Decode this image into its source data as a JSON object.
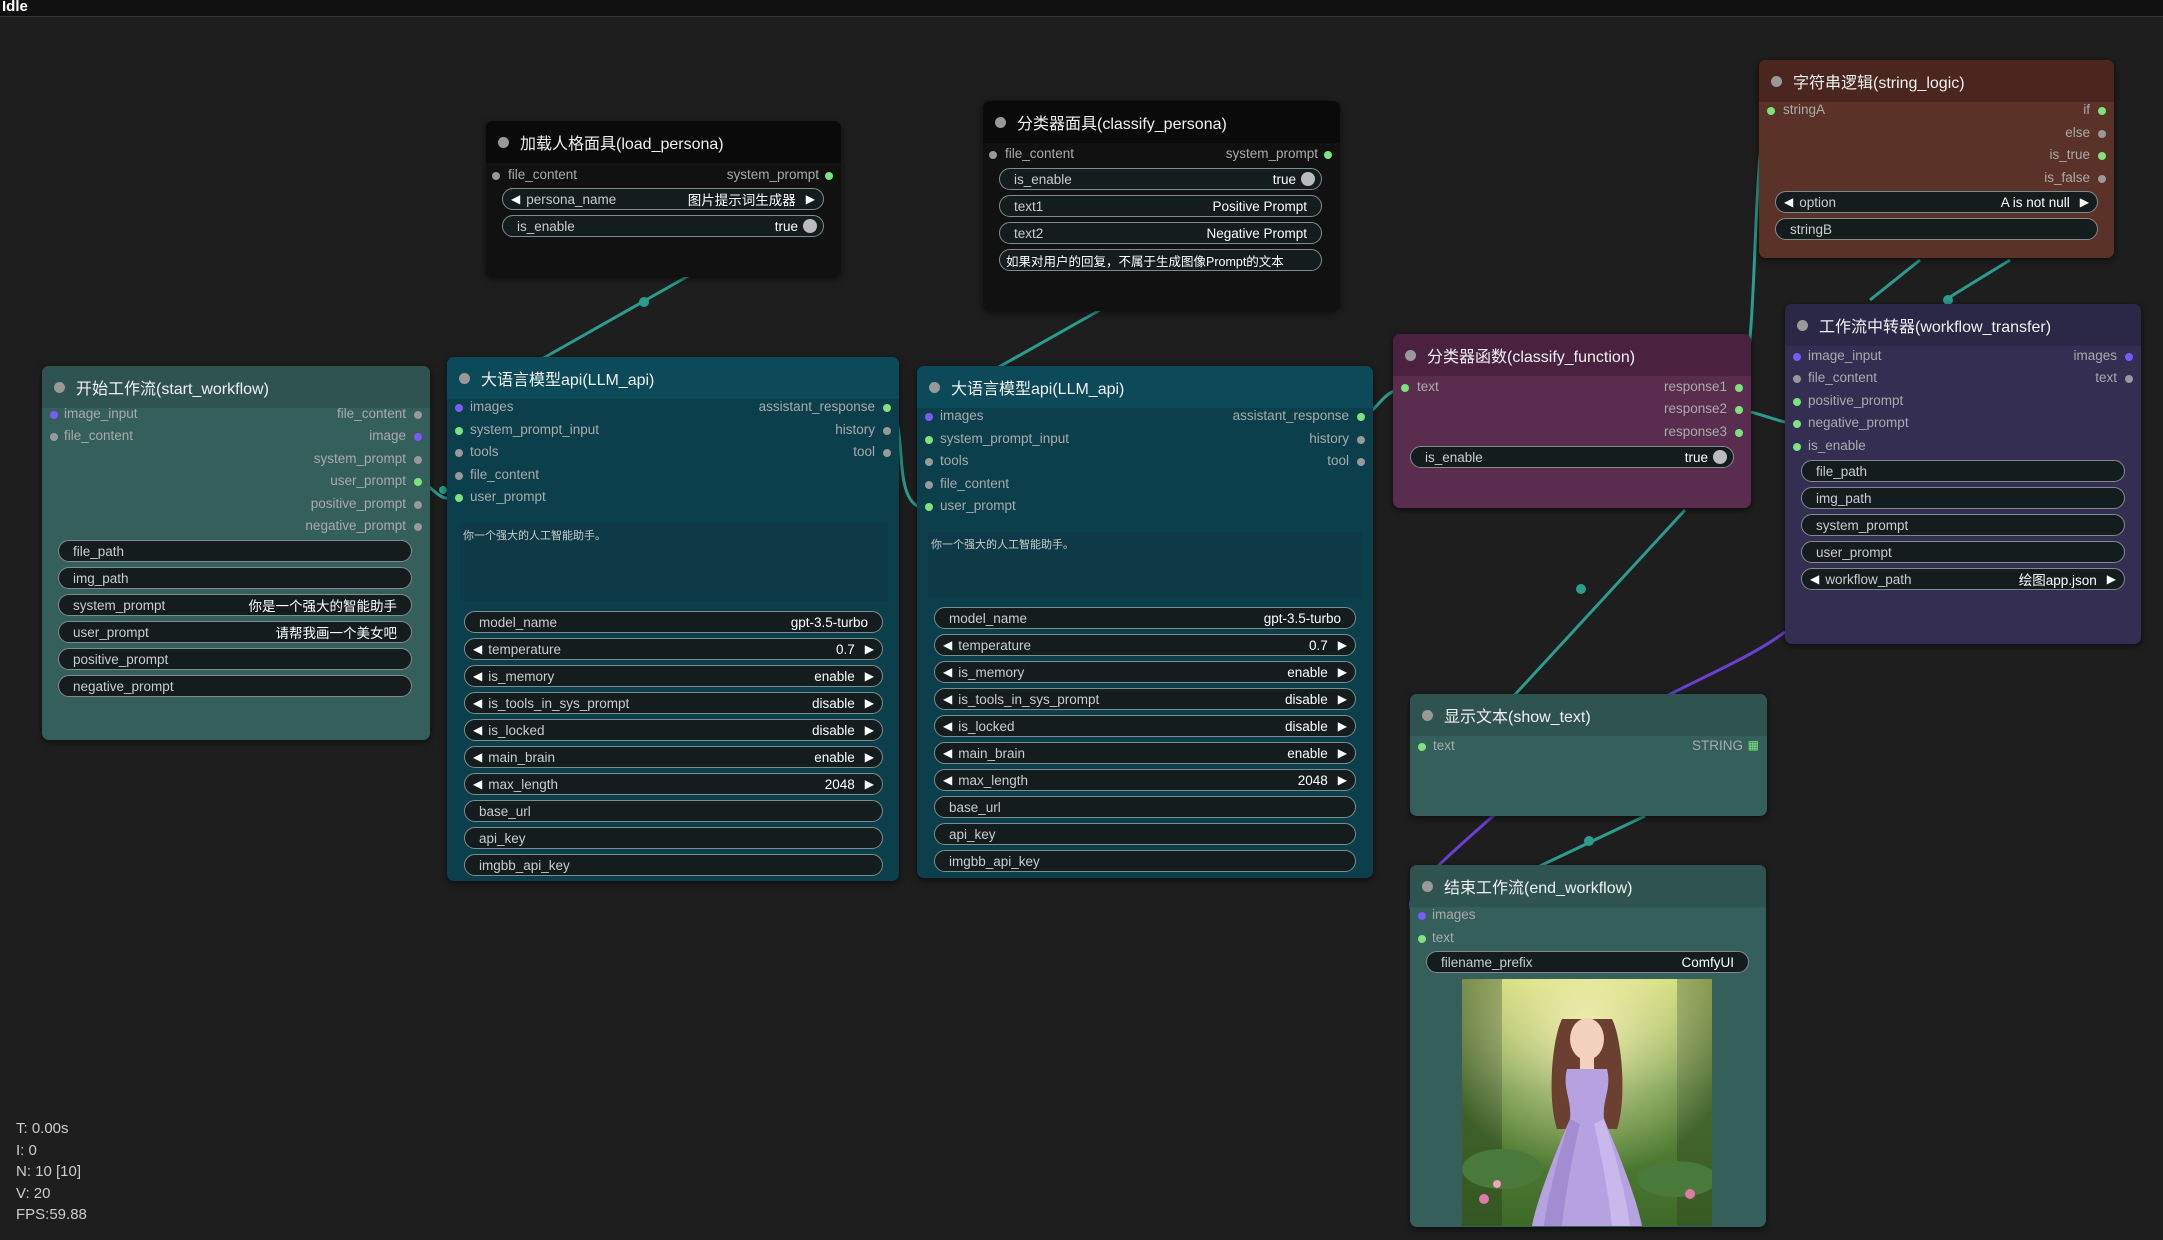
{
  "status": "Idle",
  "stats": {
    "t": "T: 0.00s",
    "i": "I: 0",
    "n": "N: 10 [10]",
    "v": "V: 20",
    "fps": "FPS:59.88"
  },
  "nodes": {
    "start_workflow": {
      "title": "开始工作流(start_workflow)",
      "inputs": [
        "image_input",
        "file_content"
      ],
      "outputs": [
        "file_content",
        "image",
        "system_prompt",
        "user_prompt",
        "positive_prompt",
        "negative_prompt"
      ],
      "widgets": {
        "file_path": {
          "label": "file_path",
          "value": ""
        },
        "img_path": {
          "label": "img_path",
          "value": ""
        },
        "system_prompt": {
          "label": "system_prompt",
          "value": "你是一个强大的智能助手"
        },
        "user_prompt": {
          "label": "user_prompt",
          "value": "请帮我画一个美女吧"
        },
        "positive_prompt": {
          "label": "positive_prompt",
          "value": ""
        },
        "negative_prompt": {
          "label": "negative_prompt",
          "value": ""
        }
      }
    },
    "load_persona": {
      "title": "加载人格面具(load_persona)",
      "input": "file_content",
      "output": "system_prompt",
      "persona_name": {
        "label": "persona_name",
        "value": "图片提示词生成器"
      },
      "is_enable": {
        "label": "is_enable",
        "value": "true"
      }
    },
    "llm1": {
      "title": "大语言模型api(LLM_api)",
      "inputs": [
        "images",
        "system_prompt_input",
        "tools",
        "file_content",
        "user_prompt"
      ],
      "outputs": [
        "assistant_response",
        "history",
        "tool"
      ],
      "text": "你一个强大的人工智能助手。",
      "widgets": {
        "model_name": {
          "label": "model_name",
          "value": "gpt-3.5-turbo"
        },
        "temperature": {
          "label": "temperature",
          "value": "0.7"
        },
        "is_memory": {
          "label": "is_memory",
          "value": "enable"
        },
        "is_tools_in_sys_prompt": {
          "label": "is_tools_in_sys_prompt",
          "value": "disable"
        },
        "is_locked": {
          "label": "is_locked",
          "value": "disable"
        },
        "main_brain": {
          "label": "main_brain",
          "value": "enable"
        },
        "max_length": {
          "label": "max_length",
          "value": "2048"
        },
        "base_url": {
          "label": "base_url",
          "value": ""
        },
        "api_key": {
          "label": "api_key",
          "value": ""
        },
        "imgbb_api_key": {
          "label": "imgbb_api_key",
          "value": ""
        }
      }
    },
    "classify_persona": {
      "title": "分类器面具(classify_persona)",
      "input": "file_content",
      "output": "system_prompt",
      "is_enable": {
        "label": "is_enable",
        "value": "true"
      },
      "text1": {
        "label": "text1",
        "value": "Positive Prompt"
      },
      "text2": {
        "label": "text2",
        "value": "Negative Prompt"
      },
      "text3": "如果对用户的回复，不属于生成图像Prompt的文本"
    },
    "llm2": {
      "title": "大语言模型api(LLM_api)",
      "inputs": [
        "images",
        "system_prompt_input",
        "tools",
        "file_content",
        "user_prompt"
      ],
      "outputs": [
        "assistant_response",
        "history",
        "tool"
      ],
      "text": "你一个强大的人工智能助手。",
      "widgets": {
        "model_name": {
          "label": "model_name",
          "value": "gpt-3.5-turbo"
        },
        "temperature": {
          "label": "temperature",
          "value": "0.7"
        },
        "is_memory": {
          "label": "is_memory",
          "value": "enable"
        },
        "is_tools_in_sys_prompt": {
          "label": "is_tools_in_sys_prompt",
          "value": "disable"
        },
        "is_locked": {
          "label": "is_locked",
          "value": "disable"
        },
        "main_brain": {
          "label": "main_brain",
          "value": "enable"
        },
        "max_length": {
          "label": "max_length",
          "value": "2048"
        },
        "base_url": {
          "label": "base_url",
          "value": ""
        },
        "api_key": {
          "label": "api_key",
          "value": ""
        },
        "imgbb_api_key": {
          "label": "imgbb_api_key",
          "value": ""
        }
      }
    },
    "classify_function": {
      "title": "分类器函数(classify_function)",
      "input": "text",
      "outputs": [
        "response1",
        "response2",
        "response3"
      ],
      "is_enable": {
        "label": "is_enable",
        "value": "true"
      }
    },
    "string_logic": {
      "title": "字符串逻辑(string_logic)",
      "input": "stringA",
      "outputs": [
        "if",
        "else",
        "is_true",
        "is_false"
      ],
      "option": {
        "label": "option",
        "value": "A is not null"
      },
      "stringB": {
        "label": "stringB",
        "value": ""
      }
    },
    "workflow_transfer": {
      "title": "工作流中转器(workflow_transfer)",
      "inputs": [
        "image_input",
        "file_content",
        "positive_prompt",
        "negative_prompt",
        "is_enable"
      ],
      "outputs": [
        "images",
        "text"
      ],
      "widgets": {
        "file_path": {
          "label": "file_path",
          "value": ""
        },
        "img_path": {
          "label": "img_path",
          "value": ""
        },
        "system_prompt": {
          "label": "system_prompt",
          "value": ""
        },
        "user_prompt": {
          "label": "user_prompt",
          "value": ""
        },
        "workflow_path": {
          "label": "workflow_path",
          "value": "绘图app.json"
        }
      }
    },
    "show_text": {
      "title": "显示文本(show_text)",
      "input": "text",
      "output": "STRING"
    },
    "end_workflow": {
      "title": "结束工作流(end_workflow)",
      "inputs": [
        "images",
        "text"
      ],
      "filename_prefix": {
        "label": "filename_prefix",
        "value": "ComfyUI"
      }
    }
  },
  "colors": {
    "canvas": "#1e1e1e",
    "teal_node": "#355f5a",
    "llm_node": "#0b3f4c",
    "persona_node": "#111111",
    "classify_fn_node": "#5a2d4e",
    "string_logic_node": "#5b3228",
    "transfer_node": "#332e52",
    "wire_teal": "#2a9d8f",
    "wire_purple": "#6a3fd1",
    "pin_green": "#7de37d",
    "pin_purple": "#7a5af8"
  }
}
